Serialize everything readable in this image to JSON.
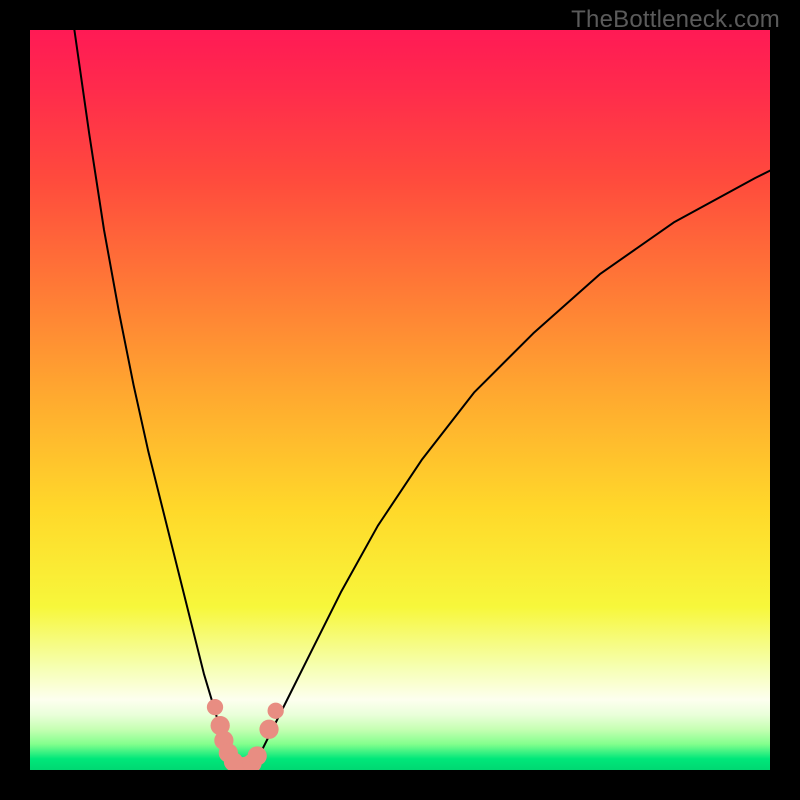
{
  "watermark": "TheBottleneck.com",
  "colors": {
    "frame": "#000000",
    "gradient_stops": [
      {
        "offset": 0.0,
        "color": "#ff1a55"
      },
      {
        "offset": 0.08,
        "color": "#ff2b4c"
      },
      {
        "offset": 0.2,
        "color": "#ff4a3d"
      },
      {
        "offset": 0.35,
        "color": "#ff7a36"
      },
      {
        "offset": 0.5,
        "color": "#ffab2f"
      },
      {
        "offset": 0.65,
        "color": "#ffd92a"
      },
      {
        "offset": 0.78,
        "color": "#f7f73b"
      },
      {
        "offset": 0.86,
        "color": "#f6ffb0"
      },
      {
        "offset": 0.905,
        "color": "#fdffef"
      },
      {
        "offset": 0.925,
        "color": "#eaffda"
      },
      {
        "offset": 0.945,
        "color": "#c6ffb3"
      },
      {
        "offset": 0.965,
        "color": "#83ff8d"
      },
      {
        "offset": 0.985,
        "color": "#00e77a"
      },
      {
        "offset": 1.0,
        "color": "#00d872"
      }
    ],
    "curve_stroke": "#000000",
    "marker_fill": "#e88d82",
    "watermark_text": "#5b5b5b"
  },
  "chart_data": {
    "type": "line",
    "title": "",
    "xlabel": "",
    "ylabel": "",
    "xlim": [
      0,
      100
    ],
    "ylim": [
      0,
      100
    ],
    "series": [
      {
        "name": "left-branch",
        "x": [
          6,
          8,
          10,
          12,
          14,
          16,
          18,
          20,
          22,
          23.5,
          25,
          26,
          27,
          27.8
        ],
        "y": [
          100,
          86,
          73,
          62,
          52,
          43,
          35,
          27,
          19,
          13,
          8,
          4.5,
          2,
          0.5
        ]
      },
      {
        "name": "right-branch",
        "x": [
          30.2,
          31,
          32.5,
          35,
          38,
          42,
          47,
          53,
          60,
          68,
          77,
          87,
          98,
          100
        ],
        "y": [
          0.5,
          2,
          5,
          10,
          16,
          24,
          33,
          42,
          51,
          59,
          67,
          74,
          80,
          81
        ]
      },
      {
        "name": "valley-floor",
        "x": [
          27.8,
          28.5,
          29.3,
          30.2
        ],
        "y": [
          0.5,
          0.2,
          0.2,
          0.5
        ]
      }
    ],
    "markers": [
      {
        "x": 25.0,
        "y": 8.5,
        "r": 1.1
      },
      {
        "x": 25.7,
        "y": 6.0,
        "r": 1.3
      },
      {
        "x": 26.2,
        "y": 4.0,
        "r": 1.3
      },
      {
        "x": 26.8,
        "y": 2.3,
        "r": 1.3
      },
      {
        "x": 27.5,
        "y": 1.1,
        "r": 1.3
      },
      {
        "x": 28.3,
        "y": 0.5,
        "r": 1.3
      },
      {
        "x": 29.2,
        "y": 0.5,
        "r": 1.3
      },
      {
        "x": 30.0,
        "y": 0.9,
        "r": 1.3
      },
      {
        "x": 30.7,
        "y": 1.9,
        "r": 1.3
      },
      {
        "x": 32.3,
        "y": 5.5,
        "r": 1.3
      },
      {
        "x": 33.2,
        "y": 8.0,
        "r": 1.1
      }
    ]
  }
}
